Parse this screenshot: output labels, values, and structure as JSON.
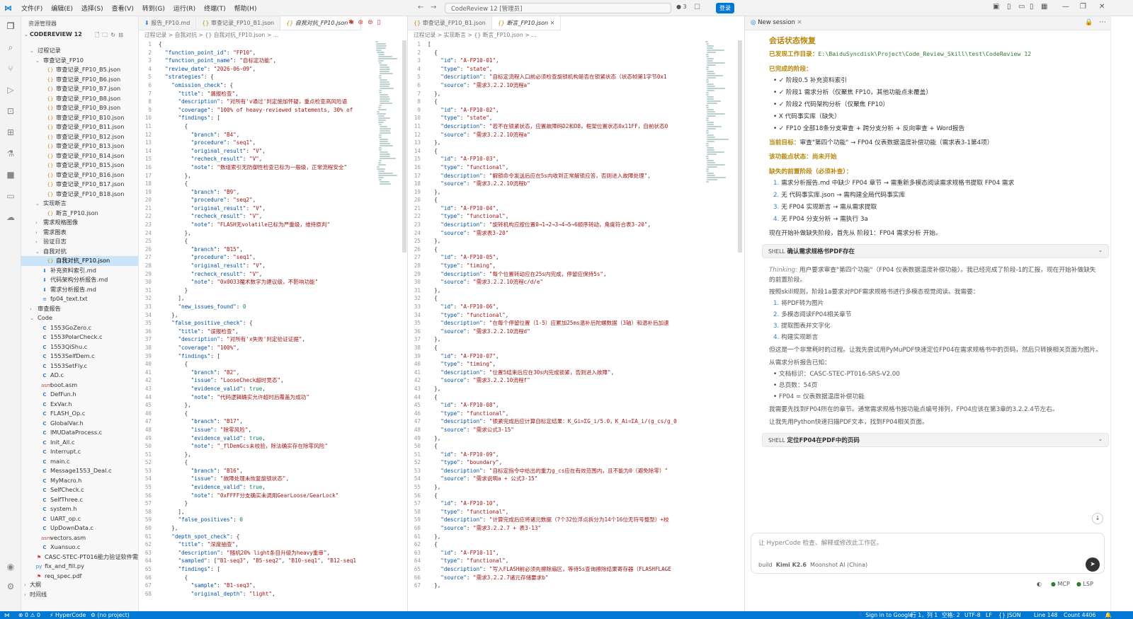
{
  "titlebar": {
    "menu": [
      "文件(F)",
      "编辑(E)",
      "选择(S)",
      "查看(V)",
      "转到(G)",
      "运行(R)",
      "终端(T)",
      "帮助(H)"
    ],
    "command_center": "CodeReview 12 [管理员]",
    "count": "3",
    "login": "登录"
  },
  "sidebar": {
    "title": "资源管理器",
    "workspace": "CODEREVIEW 12",
    "items": [
      {
        "label": "过程记录",
        "type": "folder",
        "depth": 1,
        "open": true
      },
      {
        "label": "审查记录_FP10",
        "type": "folder",
        "depth": 2,
        "open": true
      },
      {
        "label": "审查记录_FP10_B5.json",
        "type": "json",
        "depth": 3
      },
      {
        "label": "审查记录_FP10_B6.json",
        "type": "json",
        "depth": 3
      },
      {
        "label": "审查记录_FP10_B7.json",
        "type": "json",
        "depth": 3
      },
      {
        "label": "审查记录_FP10_B8.json",
        "type": "json",
        "depth": 3
      },
      {
        "label": "审查记录_FP10_B9.json",
        "type": "json",
        "depth": 3
      },
      {
        "label": "审查记录_FP10_B10.json",
        "type": "json",
        "depth": 3
      },
      {
        "label": "审查记录_FP10_B11.json",
        "type": "json",
        "depth": 3
      },
      {
        "label": "审查记录_FP10_B12.json",
        "type": "json",
        "depth": 3
      },
      {
        "label": "审查记录_FP10_B13.json",
        "type": "json",
        "depth": 3
      },
      {
        "label": "审查记录_FP10_B14.json",
        "type": "json",
        "depth": 3
      },
      {
        "label": "审查记录_FP10_B15.json",
        "type": "json",
        "depth": 3
      },
      {
        "label": "审查记录_FP10_B16.json",
        "type": "json",
        "depth": 3
      },
      {
        "label": "审查记录_FP10_B17.json",
        "type": "json",
        "depth": 3
      },
      {
        "label": "审查记录_FP10_B18.json",
        "type": "json",
        "depth": 3
      },
      {
        "label": "实现断言",
        "type": "folder",
        "depth": 2,
        "open": true
      },
      {
        "label": "断言_FP10.json",
        "type": "json",
        "depth": 3
      },
      {
        "label": "需求规格图像",
        "type": "folder",
        "depth": 2,
        "open": false
      },
      {
        "label": "需求图表",
        "type": "folder",
        "depth": 2,
        "open": false
      },
      {
        "label": "验证日志",
        "type": "folder",
        "depth": 2,
        "open": false
      },
      {
        "label": "自我对抗",
        "type": "folder",
        "depth": 2,
        "open": true
      },
      {
        "label": "自我对抗_FP10.json",
        "type": "json",
        "depth": 3,
        "selected": true
      },
      {
        "label": "补充资料索引.md",
        "type": "md",
        "depth": 2
      },
      {
        "label": "代码架构分析报告.md",
        "type": "md",
        "depth": 2
      },
      {
        "label": "需求分析报告.md",
        "type": "md",
        "depth": 2
      },
      {
        "label": "fp04_text.txt",
        "type": "txt",
        "depth": 2
      },
      {
        "label": "审查报告",
        "type": "folder",
        "depth": 1,
        "open": false
      },
      {
        "label": "Code",
        "type": "folder",
        "depth": 1,
        "open": true
      },
      {
        "label": "1553GoZero.c",
        "type": "c",
        "depth": 2
      },
      {
        "label": "1553PolarCheck.c",
        "type": "c",
        "depth": 2
      },
      {
        "label": "1553QiShu.c",
        "type": "c",
        "depth": 2
      },
      {
        "label": "1553SelfDem.c",
        "type": "c",
        "depth": 2
      },
      {
        "label": "1553SetFly.c",
        "type": "c",
        "depth": 2
      },
      {
        "label": "AD.c",
        "type": "c",
        "depth": 2
      },
      {
        "label": "boot.asm",
        "type": "asm",
        "depth": 2
      },
      {
        "label": "DefFun.h",
        "type": "c",
        "depth": 2
      },
      {
        "label": "ExVar.h",
        "type": "c",
        "depth": 2
      },
      {
        "label": "FLASH_Op.c",
        "type": "c",
        "depth": 2
      },
      {
        "label": "GlobalVar.h",
        "type": "c",
        "depth": 2
      },
      {
        "label": "IMUDataProcess.c",
        "type": "c",
        "depth": 2
      },
      {
        "label": "Init_All.c",
        "type": "c",
        "depth": 2
      },
      {
        "label": "Interrupt.c",
        "type": "c",
        "depth": 2
      },
      {
        "label": "main.c",
        "type": "c",
        "depth": 2
      },
      {
        "label": "Message1553_Deal.c",
        "type": "c",
        "depth": 2
      },
      {
        "label": "MyMacro.h",
        "type": "c",
        "depth": 2
      },
      {
        "label": "SelfCheck.c",
        "type": "c",
        "depth": 2
      },
      {
        "label": "SelfThree.c",
        "type": "c",
        "depth": 2
      },
      {
        "label": "system.h",
        "type": "c",
        "depth": 2
      },
      {
        "label": "UART_op.c",
        "type": "c",
        "depth": 2
      },
      {
        "label": "UpDownData.c",
        "type": "c",
        "depth": 2
      },
      {
        "label": "vectors.asm",
        "type": "asm",
        "depth": 2
      },
      {
        "label": "Xuansuo.c",
        "type": "c",
        "depth": 2
      },
      {
        "label": "CASC-STEC-PT016能力验证软件需求规...",
        "type": "pdf",
        "depth": 1
      },
      {
        "label": "fix_and_fill.py",
        "type": "py",
        "depth": 1
      },
      {
        "label": "req_spec.pdf",
        "type": "pdf",
        "depth": 1
      }
    ],
    "bottom": [
      "大纲",
      "时间线"
    ]
  },
  "editorA": {
    "tabs": [
      "报告_FP10.md",
      "审查记录_FP10_B1.json",
      "自我对抗_FP10.json"
    ],
    "breadcrumb": "过程记录 > 自我对抗 > {} 自我对抗_FP10.json > ...",
    "lines": [
      "{",
      "  \"function_point_id\": \"FP10\",",
      "  \"function_point_name\": \"自标定功能\",",
      "  \"review_date\": \"2026-06-09\",",
      "  \"strategies\": {",
      "    \"omission_check\": {",
      "      \"title\": \"漏报检查\",",
      "      \"description\": \"对所有'v通过'判定施加怀疑，重点检查高风险语",
      "      \"coverage\": \"100% of heavy-reviewed statements, 30% of",
      "      \"findings\": [",
      "        {",
      "          \"branch\": \"B4\",",
      "          \"procedure\": \"seq1\",",
      "          \"original_result\": \"V\",",
      "          \"recheck_result\": \"V\",",
      "          \"note\": \"数组索引无防御性检查已标为一般级，正常流程安全\"",
      "        },",
      "        {",
      "          \"branch\": \"B9\",",
      "          \"procedure\": \"seq2\",",
      "          \"original_result\": \"V\",",
      "          \"recheck_result\": \"V\",",
      "          \"note\": \"FLASH无volatile已标为严重级，维持原判\"",
      "        },",
      "        {",
      "          \"branch\": \"B15\",",
      "          \"procedure\": \"seq1\",",
      "          \"original_result\": \"V\",",
      "          \"recheck_result\": \"V\",",
      "          \"note\": \"0x0033魔术数字为建议级，不影响功能\"",
      "        }",
      "      ],",
      "      \"new_issues_found\": 0",
      "    },",
      "    \"false_positive_check\": {",
      "      \"title\": \"误报检查\",",
      "      \"description\": \"对所有'x失败'判定验证证据\",",
      "      \"coverage\": \"100%\",",
      "      \"findings\": [",
      "        {",
      "          \"branch\": \"B2\",",
      "          \"issue\": \"LooseCheck超时竞态\",",
      "          \"evidence_valid\": true,",
      "          \"note\": \"代码逻辑确实允许超时后覆盖为成功\"",
      "        },",
      "        {",
      "          \"branch\": \"B17\",",
      "          \"issue\": \"除零风险\",",
      "          \"evidence_valid\": true,",
      "          \"note\": \"_flDemGcs未校验，除法确实存在除零风险\"",
      "        },",
      "        {",
      "          \"branch\": \"B16\",",
      "          \"issue\": \"故障处理未恢复旋锁状态\",",
      "          \"evidence_valid\": true,",
      "          \"note\": \"0xFFFF分支确实未调用GearLoose/GearLock\"",
      "        }",
      "      ],",
      "      \"false_positives\": 0",
      "    },",
      "    \"depth_spot_check\": {",
      "      \"title\": \"深度抽查\",",
      "      \"description\": \"随机20% light条目升级为heavy重审\",",
      "      \"sampled\": [\"B1-seq3\", \"B5-seq2\", \"B10-seq1\", \"B12-seq1",
      "      \"findings\": [",
      "        {",
      "          \"sample\": \"B1-seq3\",",
      "          \"original_depth\": \"light\","
    ]
  },
  "editorB": {
    "tabs": [
      "审查记录_FP10_B1.json",
      "断言_FP10.json"
    ],
    "breadcrumb": "过程记录 > 实现断言 > {} 断言_FP10.json > ...",
    "lines": [
      "[",
      "  {",
      "    \"id\": \"A-FP10-01\",",
      "    \"type\": \"state\",",
      "    \"description\": \"自标定流程入口前必须检查旋锁机构是否在锁紧状态（状态帧第1字节0x1",
      "    \"source\": \"需求3.2.2.10流程a\"",
      "  },",
      "  {",
      "    \"id\": \"A-FP10-02\",",
      "    \"type\": \"state\",",
      "    \"description\": \"若不在锁紧状态，应置故障码D2和D8，框架位置状态0x11FF，自前状态0",
      "    \"source\": \"需求3.2.2.10流程a\"",
      "  },",
      "  {",
      "    \"id\": \"A-FP10-03\",",
      "    \"type\": \"functional\",",
      "    \"description\": \"解锁命令发送后应在5s内收到正常解锁应答，否则进入故障处理\",",
      "    \"source\": \"需求3.2.2.10流程b\"",
      "  },",
      "  {",
      "    \"id\": \"A-FP10-04\",",
      "    \"type\": \"functional\",",
      "    \"description\": \"旋转机构应按位置0→1→2→3→4→5→6顺序转动，角度符合表3-20\",",
      "    \"source\": \"需求表3-20\"",
      "  },",
      "  {",
      "    \"id\": \"A-FP10-05\",",
      "    \"type\": \"timing\",",
      "    \"description\": \"每个位置转动应在25s内完成，停留应保持5s\",",
      "    \"source\": \"需求3.2.2.10流程c/d/e\"",
      "  },",
      "  {",
      "    \"id\": \"A-FP10-06\",",
      "    \"type\": \"functional\",",
      "    \"description\": \"在每个停留位置（1-5）应累加25ms温补后陀螺数据（3轴）和温补后加速",
      "    \"source\": \"需求3.2.2.10流程d\"",
      "  },",
      "  {",
      "    \"id\": \"A-FP10-07\",",
      "    \"type\": \"timing\",",
      "    \"description\": \"位置5结束后应在30s内完成锁紧，否则进入故障\",",
      "    \"source\": \"需求3.2.2.10流程f\"",
      "  },",
      "  {",
      "    \"id\": \"A-FP10-08\",",
      "    \"type\": \"functional\",",
      "    \"description\": \"锁紧完成后应计算自标定结果：K_Gi=ΣG_i/5.0，K_Ai=ΣA_i/(g_cs/g_0",
      "    \"source\": \"需求公式3-15\"",
      "  },",
      "  {",
      "    \"id\": \"A-FP10-09\",",
      "    \"type\": \"boundary\",",
      "    \"description\": \"自标定指令中给出的重力g_cs应在有效范围内，且不能为0（避免除零）\"",
      "    \"source\": \"需求说明a + 公式3-15\"",
      "  },",
      "  {",
      "    \"id\": \"A-FP10-10\",",
      "    \"type\": \"functional\",",
      "    \"description\": \"计算完成后应将诸元数据（7个32位浮点拆分为14个16位无符号整型）+校",
      "    \"source\": \"需求3.2.2.7 + 表3-13\"",
      "  },",
      "  {",
      "    \"id\": \"A-FP10-11\",",
      "    \"type\": \"functional\",",
      "    \"description\": \"写入FLASH前必须先擦除扇区，等待5s查询擦除结果寄存器（FLASHFLAGE",
      "    \"source\": \"需求3.2.2.7诸元存储要求b\"",
      "  },"
    ]
  },
  "chat": {
    "tab": "New session",
    "section_title": "会话状态恢复",
    "workdir_label": "已发现工作目录：",
    "workdir": "E:\\BaiduSyncdisk\\Project\\Code_Review_Skill\\test\\CodeReview 12",
    "done_label": "已完成的阶段：",
    "done": [
      "✓ 阶段0.5 补充资料索引",
      "✓ 阶段1 需求分析（仅聚焦 FP10，其他功能点未覆盖）",
      "✓ 阶段2 代码架构分析（仅聚焦 FP10）",
      "X 代码事实库（缺失）",
      "✓ FP10 全部18条分支审查 + 跨分支分析 + 反向审查 + Word报告"
    ],
    "goal_label": "当前目标：",
    "goal": "审查\"第四个功能\" → FP04 仪表数据温度补偿功能（需求表3-1第4项）",
    "read_state_label": "该功能点状态：",
    "read_state": "尚未开始",
    "missing_label": "缺失的前置阶段（必须补查）：",
    "missing": [
      "需求分析报告.md 中缺少 FP04 章节 → 需重新多模态阅读需求规格书提取 FP04 需求",
      "无 代码事实库.json → 需构建全局代码事实库",
      "无 FP04 实现断言 → 需从需求提取",
      "无 FP04 分支分析 → 需执行 3a"
    ],
    "start_text": "现在开始补做缺失阶段，首先从 阶段1：FP04 需求分析 开始。",
    "shell1_label": "SHELL",
    "shell1": "确认需求规格书PDF存在",
    "thinking_label": "Thinking:",
    "thinking": "用户要求审查\"第四个功能\"（FP04 仪表数据温度补偿功能）。我已经完成了阶段-1的汇报，现在开始补做缺失的前置阶段。",
    "skill_rule": "按照skill规则，阶段1a要求对PDF需求规格书进行多模态视觉阅读。我需要：",
    "steps": [
      "将PDF转为图片",
      "多模态阅读FP04相关章节",
      "提取图表并文字化",
      "构建实现断言"
    ],
    "time_note": "但这是一个非常耗时的过程。让我先尝试用PyMuPDF快速定位FP04在需求规格书中的页码，然后只转换相关页面为图片。",
    "known_label": "从需求分析报告已知：",
    "known": [
      "文档标识：CASC-STEC-PT016-SRS-V2.00",
      "总页数：54页",
      "FP04 = 仪表数据温度补偿功能"
    ],
    "find_note": "我需要先找到FP04所在的章节。通常需求规格书按功能点编号排列，FP04应该在第3章的3.2.2.4节左右。",
    "scan_note": "让我先用Python快速扫描PDF文本，找到FP04相关页面。",
    "shell2_label": "SHELL",
    "shell2": "定位FP04在PDF中的页码",
    "input_placeholder": "让 HyperCode 检查、解释或修改此工作区。",
    "mode": "build",
    "model": "Kimi K2.6",
    "provider": "Moonshot AI (China)",
    "footer_mcp": "MCP",
    "footer_lsp": "LSP"
  },
  "statusbar": {
    "errors": "0",
    "warnings": "0",
    "hypercode": "HyperCode",
    "project": "(no project)",
    "signin": "Sign in to Google",
    "position": "行 1，列 1",
    "spaces": "空格: 2",
    "encoding": "UTF-8",
    "eol": "LF",
    "lang": "{} JSON",
    "line": "Line 148",
    "count": "Count 4406"
  }
}
